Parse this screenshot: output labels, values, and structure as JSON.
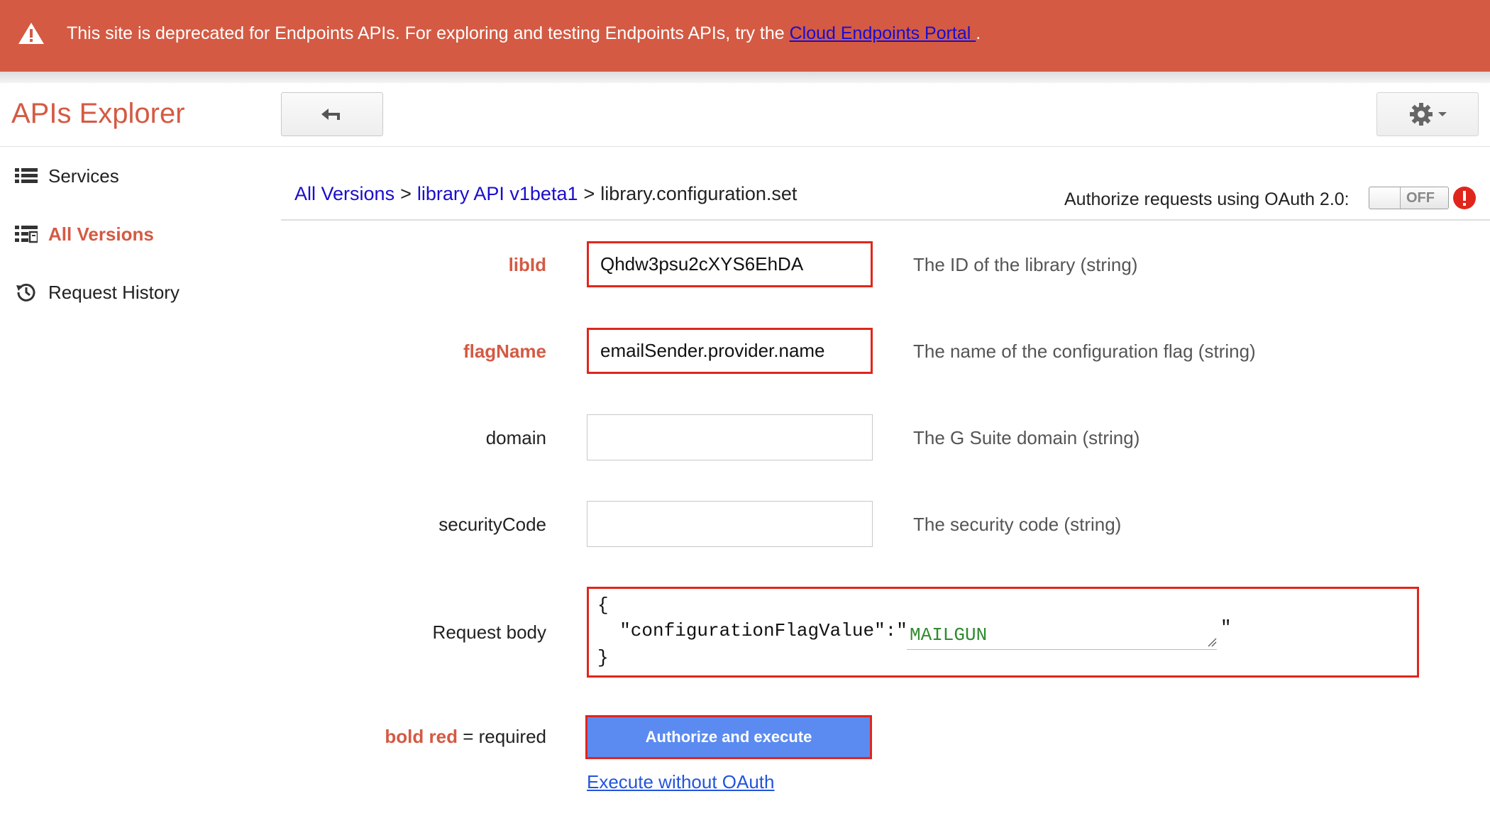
{
  "banner": {
    "message": "This site is deprecated for Endpoints APIs. For exploring and testing Endpoints APIs, try the ",
    "link_text": "Cloud Endpoints Portal ",
    "suffix": ".",
    "icon": "warning-icon",
    "background": "#d45a43"
  },
  "header": {
    "title": "APIs Explorer",
    "back_icon": "back-arrow-icon",
    "settings_icon": "gear-icon",
    "accent_color": "#d45a43"
  },
  "sidebar": {
    "items": [
      {
        "label": "Services",
        "icon": "list-icon",
        "active": false
      },
      {
        "label": "All Versions",
        "icon": "versions-list-icon",
        "active": true
      },
      {
        "label": "Request History",
        "icon": "history-icon",
        "active": false
      }
    ]
  },
  "breadcrumb": {
    "items": [
      {
        "label": "All Versions",
        "link": true
      },
      {
        "label": "library API v1beta1",
        "link": true
      },
      {
        "label": "library.configuration.set",
        "link": false
      }
    ],
    "separator": ">"
  },
  "auth": {
    "label": "Authorize requests using OAuth 2.0:",
    "toggle_state": "OFF"
  },
  "form": {
    "fields": [
      {
        "name": "libId",
        "required": true,
        "value": "Qhdw3psu2cXYS6EhDA",
        "description": "The ID of the library (string)"
      },
      {
        "name": "flagName",
        "required": true,
        "value": "emailSender.provider.name",
        "description": "The name of the configuration flag (string)"
      },
      {
        "name": "domain",
        "required": false,
        "value": "",
        "description": "The G Suite domain (string)"
      },
      {
        "name": "securityCode",
        "required": false,
        "value": "",
        "description": "The security code (string)"
      }
    ],
    "request_body": {
      "label": "Request body",
      "open_brace": "{",
      "key_line": "  \"configurationFlagValue\":\"",
      "value": "MAILGUN",
      "close_quote": "\"",
      "close_brace": "}"
    },
    "required_note": {
      "highlight": "bold red",
      "rest": " = required"
    },
    "execute_button": "Authorize and execute",
    "execute_link": "Execute without OAuth"
  }
}
